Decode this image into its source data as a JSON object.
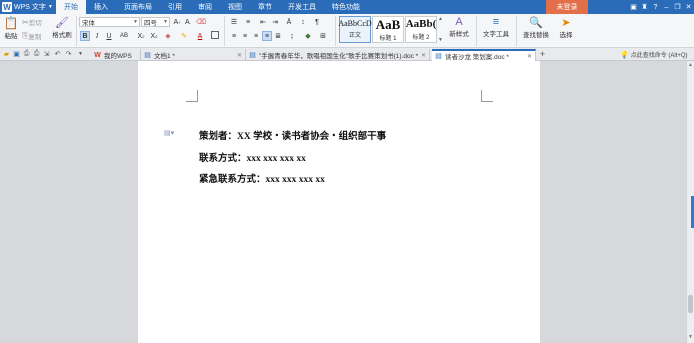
{
  "app": {
    "name": "WPS 文字",
    "logo": "W"
  },
  "menu": {
    "tabs": [
      "开始",
      "插入",
      "页面布局",
      "引用",
      "审阅",
      "视图",
      "章节",
      "开发工具",
      "特色功能"
    ],
    "active": "开始",
    "login": "未登录"
  },
  "window_controls": [
    "minimize-icon",
    "restore-icon",
    "close-icon"
  ],
  "ribbon": {
    "paste": "粘贴",
    "cut": "剪切",
    "copy": "复制",
    "format_painter": "格式刷",
    "font_name": "宋体",
    "font_size": "四号",
    "styles": [
      {
        "sample": "AaBbCcD",
        "name": "正文"
      },
      {
        "sample": "AaB",
        "name": "标题 1"
      },
      {
        "sample": "AaBb(",
        "name": "标题 2"
      }
    ],
    "new_style": "新样式",
    "text_tools": "文字工具",
    "find_replace": "查找替换",
    "select": "选择"
  },
  "doc_tabs": [
    {
      "label": "我的WPS",
      "icon": "wps-icon"
    },
    {
      "label": "文档1 *",
      "icon": "doc-icon"
    },
    {
      "label": "\"手握青春年华，歌唱祖国生化\"歌手比赛策划书(1).doc *",
      "icon": "doc-icon"
    },
    {
      "label": "读者沙龙 策划案.doc *",
      "icon": "doc-icon"
    }
  ],
  "search_hint": "点此查找命令 (Alt+Q)",
  "document": {
    "lines": [
      "策划者：XX 学校・读书者协会・组织部干事",
      "联系方式：xxx xxx xxx xx",
      "紧急联系方式：xxx xxx xxx xx"
    ]
  },
  "colors": {
    "accent": "#2b6cb9",
    "login": "#e36f4a"
  }
}
